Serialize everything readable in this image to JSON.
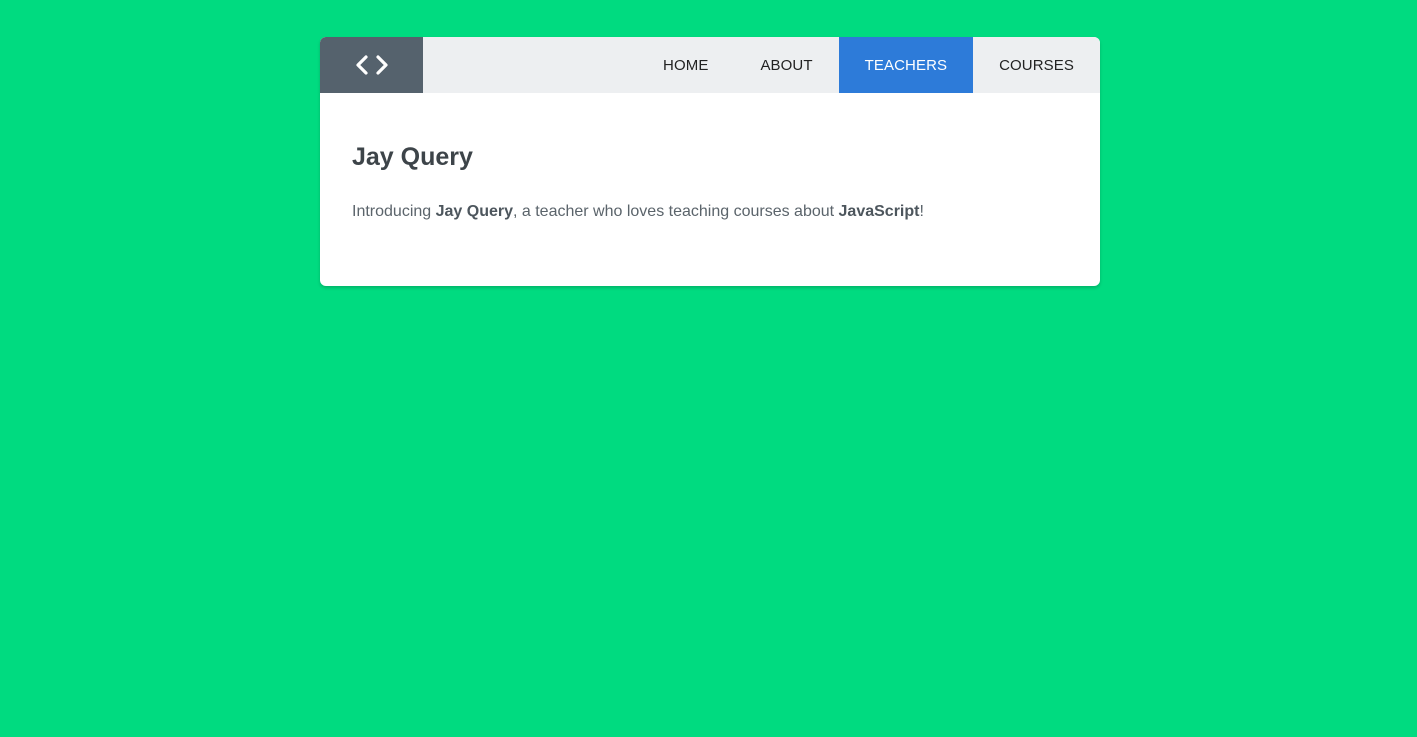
{
  "logo": {
    "icon": "code-brackets-icon",
    "background": "#55626d"
  },
  "nav": {
    "items": [
      {
        "label": "HOME",
        "active": false
      },
      {
        "label": "ABOUT",
        "active": false
      },
      {
        "label": "TEACHERS",
        "active": true
      },
      {
        "label": "COURSES",
        "active": false
      }
    ],
    "active_color": "#2d7bd9"
  },
  "teacher": {
    "name": "Jay Query",
    "intro_prefix": "Introducing ",
    "intro_name": "Jay Query",
    "intro_middle": ", a teacher who loves teaching courses about ",
    "intro_topic": "JavaScript",
    "intro_suffix": "!"
  },
  "colors": {
    "page_background": "#00db80",
    "card_background": "#ffffff",
    "navbar_background": "#edeff1"
  }
}
